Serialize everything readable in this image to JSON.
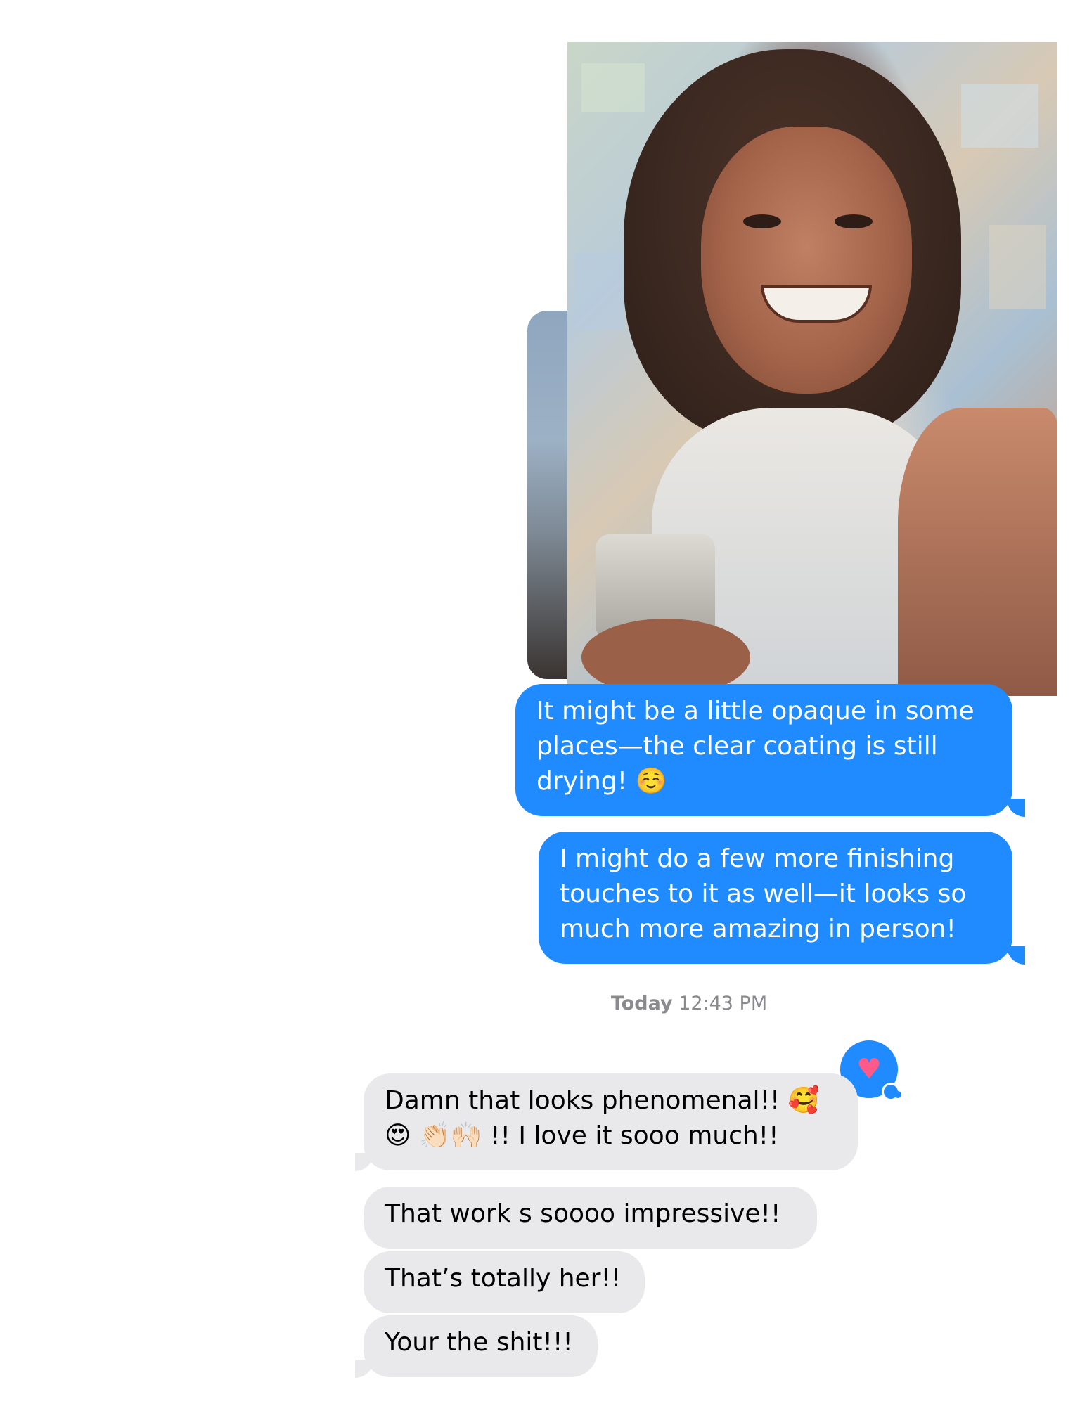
{
  "photo": {
    "description_label": ""
  },
  "outgoing": [
    {
      "text": "It might be a little opaque in some places—the clear coating is still drying! ☺️"
    },
    {
      "text": "I might do a few more finishing touches to it as well—it looks so much more amazing in person!"
    }
  ],
  "timestamp": {
    "day": "Today",
    "time": "12:43 PM"
  },
  "reaction": {
    "icon": "heart-icon",
    "symbol": "♥"
  },
  "incoming": [
    {
      "line1": "Damn that looks phenomenal!! 🥰",
      "line2": "😍 👏🏻🙌🏻 !! I love it sooo much!!"
    },
    {
      "text": "That work s soooo impressive!!"
    },
    {
      "text": "That’s totally her!!"
    },
    {
      "text": "Your the shit!!!"
    }
  ],
  "colors": {
    "outgoing_bubble": "#1f8bff",
    "incoming_bubble": "#e9e9eb",
    "timestamp": "#8a8a8e"
  }
}
